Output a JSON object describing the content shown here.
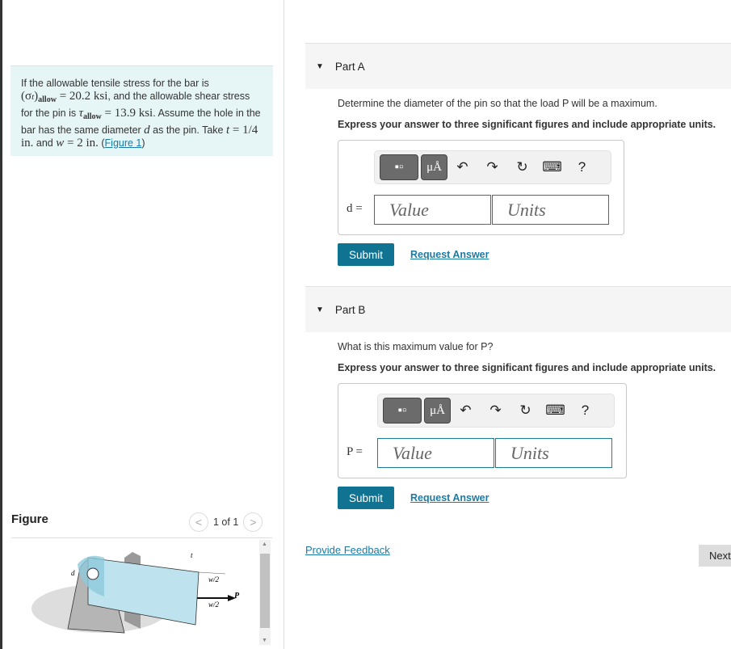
{
  "problem": {
    "t1": "If the allowable tensile stress for the bar is",
    "sigma": "(σ",
    "sigma_sub": "t",
    "sigma_close": ")",
    "allow": "allow",
    "eq1": " = 20.2 ksi",
    "t2": ", and the allowable shear stress for the pin is ",
    "tau": "τ",
    "eq2": " = 13.9 ksi",
    "t3": ". Assume the hole in the bar has the same diameter ",
    "d": "d",
    "t4": " as the pin. Take ",
    "t": "t",
    "eq3": " = 1/4 in.",
    "t5": " and ",
    "w": "w",
    "eq4": " = 2 in.",
    "t6": " (",
    "link": "Figure 1",
    "t7": ")"
  },
  "figure": {
    "title": "Figure",
    "pager": "1 of 1",
    "prev": "<",
    "next": ">",
    "labels": {
      "d": "d",
      "t": "t",
      "w1": "w/2",
      "w2": "w/2",
      "P": "P"
    }
  },
  "partA": {
    "title": "Part A",
    "question": "Determine the diameter of the pin so that the load P will be a maximum.",
    "instr": "Express your answer to three significant figures and include appropriate units.",
    "var": "d =",
    "value_ph": "Value",
    "units_ph": "Units",
    "submit": "Submit",
    "request": "Request Answer"
  },
  "partB": {
    "title": "Part B",
    "question": "What is this maximum value for P?",
    "instr": "Express your answer to three significant figures and include appropriate units.",
    "var": "P =",
    "value_ph": "Value",
    "units_ph": "Units",
    "submit": "Submit",
    "request": "Request Answer"
  },
  "toolbar": {
    "mu": "μÅ",
    "help": "?"
  },
  "feedback": "Provide Feedback",
  "next": "Next",
  "colors": {
    "accent": "#0f7391",
    "link": "#1a7ba6",
    "problem_bg": "#e6f5f6"
  }
}
